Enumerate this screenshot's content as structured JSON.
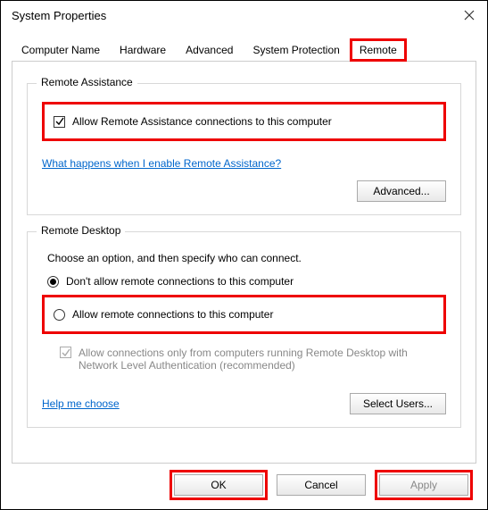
{
  "window": {
    "title": "System Properties"
  },
  "tabs": {
    "items": [
      {
        "label": "Computer Name"
      },
      {
        "label": "Hardware"
      },
      {
        "label": "Advanced"
      },
      {
        "label": "System Protection"
      },
      {
        "label": "Remote"
      }
    ],
    "active_index": 4
  },
  "remote_assistance": {
    "group_title": "Remote Assistance",
    "allow_label": "Allow Remote Assistance connections to this computer",
    "allow_checked": true,
    "help_link": "What happens when I enable Remote Assistance?",
    "advanced_btn": "Advanced..."
  },
  "remote_desktop": {
    "group_title": "Remote Desktop",
    "description": "Choose an option, and then specify who can connect.",
    "option_a": "Don't allow remote connections to this computer",
    "option_b": "Allow remote connections to this computer",
    "selected": "a",
    "nla_label": "Allow connections only from computers running Remote Desktop with Network Level Authentication (recommended)",
    "nla_checked": true,
    "help_link": "Help me choose",
    "select_users_btn": "Select Users..."
  },
  "buttons": {
    "ok": "OK",
    "cancel": "Cancel",
    "apply": "Apply"
  },
  "highlight_color": "#e00"
}
